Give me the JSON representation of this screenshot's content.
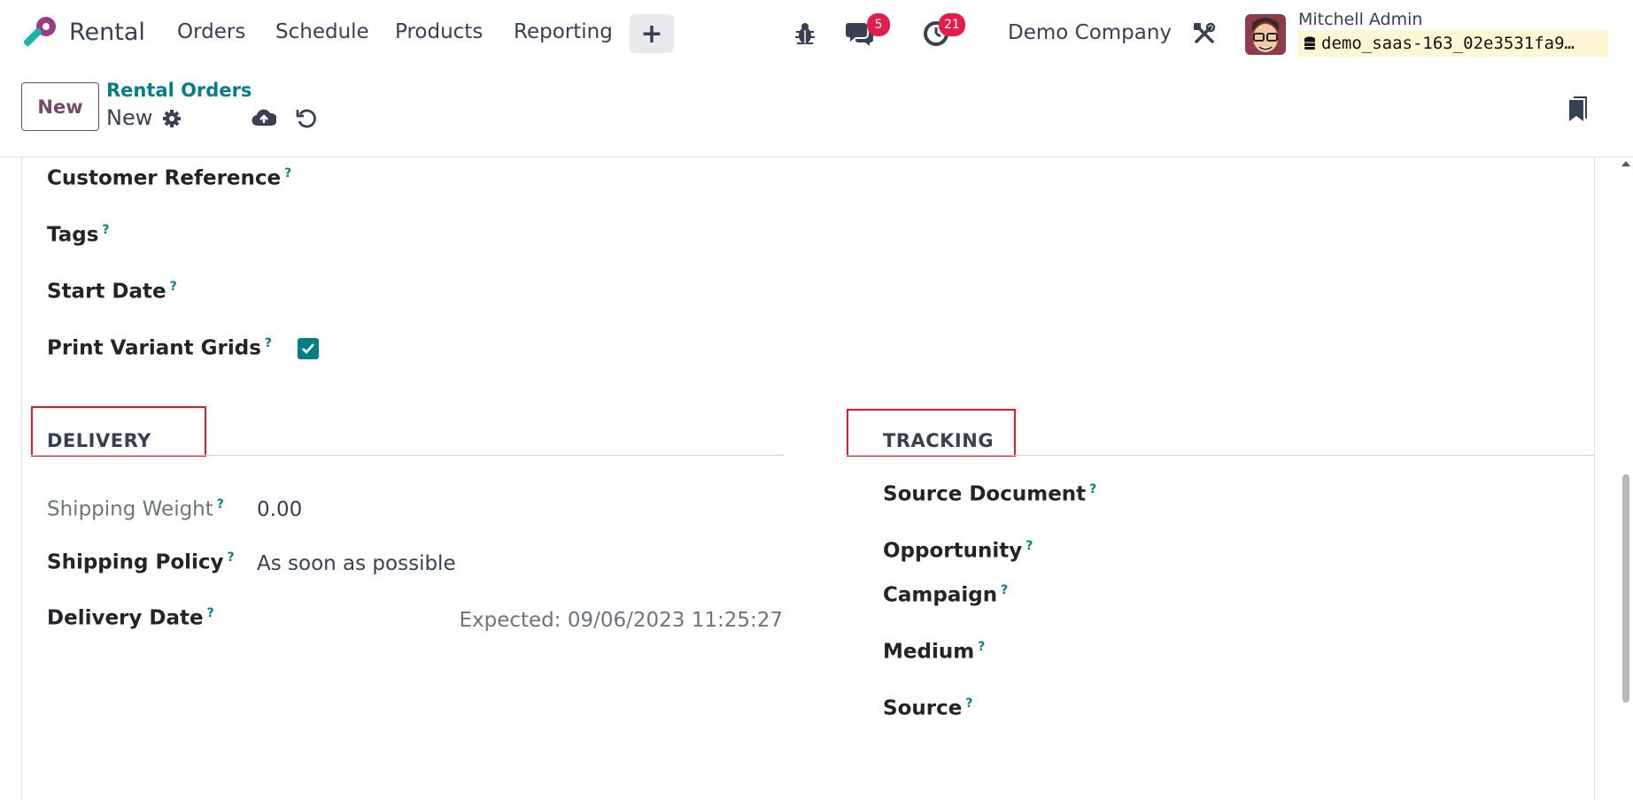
{
  "app": {
    "name": "Rental",
    "menu": [
      "Orders",
      "Schedule",
      "Products",
      "Reporting"
    ],
    "quick_create": "+",
    "messages_count": "5",
    "activities_count": "21",
    "company": "Demo Company",
    "user_name": "Mitchell Admin",
    "database": "demo_saas-163_02e3531fa9…"
  },
  "control_panel": {
    "new_label": "New",
    "breadcrumb_parent": "Rental Orders",
    "breadcrumb_current": "New"
  },
  "form": {
    "top_fields": [
      {
        "label": "Customer Reference",
        "value": ""
      },
      {
        "label": "Tags",
        "value": ""
      },
      {
        "label": "Start Date",
        "value": ""
      },
      {
        "label": "Print Variant Grids",
        "checked": true
      }
    ],
    "delivery": {
      "title": "DELIVERY",
      "fields": [
        {
          "label": "Shipping Weight",
          "value": "0.00"
        },
        {
          "label": "Shipping Policy",
          "value": "As soon as possible"
        },
        {
          "label": "Delivery Date",
          "value": "Expected: 09/06/2023 11:25:27"
        }
      ]
    },
    "tracking": {
      "title": "TRACKING",
      "fields": [
        {
          "label": "Source Document"
        },
        {
          "label": "Opportunity"
        },
        {
          "label": "Campaign"
        },
        {
          "label": "Medium"
        },
        {
          "label": "Source"
        }
      ]
    },
    "help_marker": "?"
  },
  "colors": {
    "brand": "#714b67",
    "accent": "#017e84",
    "badge": "#e11d48",
    "highlight_box": "#e31b23"
  }
}
